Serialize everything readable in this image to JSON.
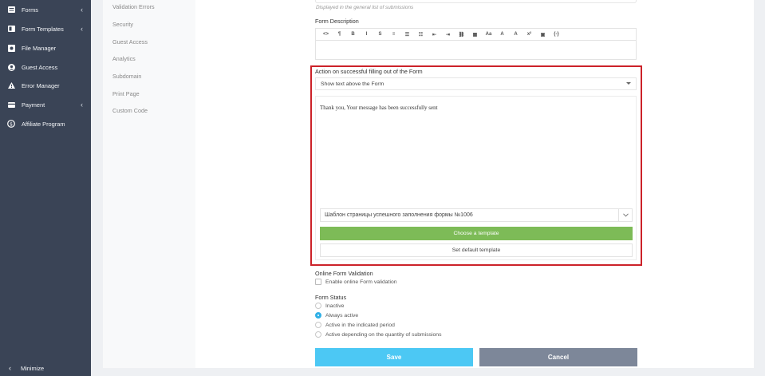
{
  "sidebar": {
    "items": [
      {
        "label": "Forms",
        "icon": "forms-icon",
        "chevron": "‹"
      },
      {
        "label": "Form Templates",
        "icon": "templates-icon",
        "chevron": "‹"
      },
      {
        "label": "File Manager",
        "icon": "file-manager-icon",
        "chevron": ""
      },
      {
        "label": "Guest Access",
        "icon": "user-icon",
        "chevron": ""
      },
      {
        "label": "Error Manager",
        "icon": "warning-icon",
        "chevron": ""
      },
      {
        "label": "Payment",
        "icon": "credit-card-icon",
        "chevron": "‹"
      },
      {
        "label": "Affiliate Program",
        "icon": "dollar-icon",
        "chevron": ""
      }
    ],
    "minimize": {
      "chevron": "‹",
      "label": "Minimize"
    }
  },
  "tabs": [
    "Validation Errors",
    "Security",
    "Guest Access",
    "Analytics",
    "Subdomain",
    "Print Page",
    "Custom Code"
  ],
  "general_hint": "Displayed in the general list of submissions",
  "form_description": {
    "label": "Form Description",
    "toolbar": [
      "<>",
      "¶",
      "B",
      "I",
      "S",
      "≡",
      "☰",
      "☷",
      "⇤",
      "⇥",
      "⛓",
      "▦",
      "Aa",
      "A",
      "A",
      "x²",
      "▣",
      "{-}"
    ]
  },
  "success_action": {
    "label": "Action on successful filling out of the Form",
    "selected": "Show text above the Form",
    "message": "Thank you, Your message has been successfully sent",
    "template_select": "Шаблон страницы успешного заполнения формы №1006",
    "choose_template_label": "Choose a template",
    "set_default_label": "Set default template"
  },
  "online_validation": {
    "label": "Online Form Validation",
    "checkbox_label": "Enable online Form validation",
    "checked": false
  },
  "form_status": {
    "label": "Form Status",
    "options": [
      {
        "label": "Inactive",
        "selected": false
      },
      {
        "label": "Always active",
        "selected": true
      },
      {
        "label": "Active in the indicated period",
        "selected": false
      },
      {
        "label": "Active depending on the quantity of submissions",
        "selected": false
      }
    ]
  },
  "actions": {
    "save_label": "Save",
    "cancel_label": "Cancel"
  },
  "colors": {
    "sidebar_bg": "#3a4456",
    "accent_green": "#7dbb57",
    "save_blue": "#4cc8f4",
    "cancel_gray": "#7d8799",
    "highlight_red": "#cc2229"
  }
}
